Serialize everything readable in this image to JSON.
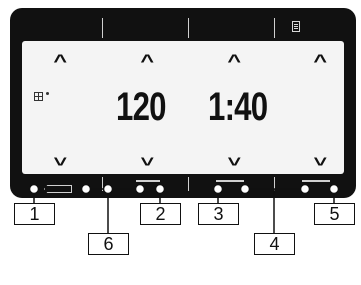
{
  "display": {
    "value_left": "120",
    "value_right": "1:40"
  },
  "icons": {
    "menu": "menu-list-icon",
    "side": "program-grid-icon"
  },
  "callouts": [
    "1",
    "2",
    "3",
    "4",
    "5",
    "6"
  ],
  "colors": {
    "panel": "#111111",
    "screen": "#f4f4f4",
    "lines": "#d0d0d0"
  }
}
